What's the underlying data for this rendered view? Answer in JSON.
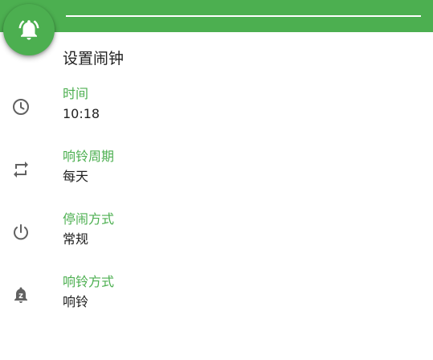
{
  "colors": {
    "accent": "#4caf50",
    "text": "#212121",
    "icon": "#616161"
  },
  "toolbar": {
    "fab_icon": "alarm-bell-icon"
  },
  "page": {
    "title": "设置闹钟"
  },
  "settings": [
    {
      "icon": "clock-icon",
      "label": "时间",
      "value": "10:18"
    },
    {
      "icon": "repeat-icon",
      "label": "响铃周期",
      "value": "每天"
    },
    {
      "icon": "power-icon",
      "label": "停闹方式",
      "value": "常规"
    },
    {
      "icon": "snooze-bell-icon",
      "label": "响铃方式",
      "value": "响铃"
    }
  ]
}
